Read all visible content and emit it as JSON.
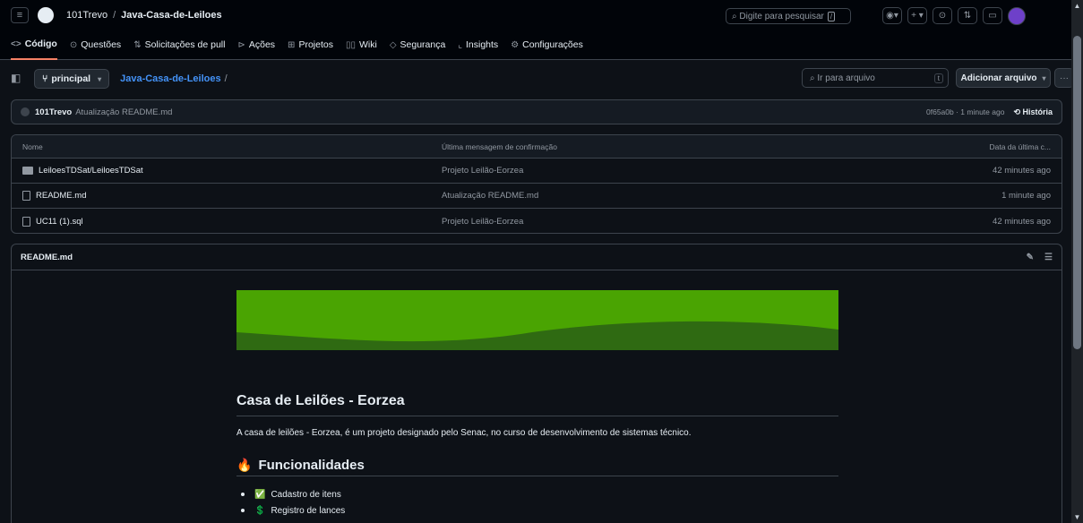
{
  "header": {
    "owner": "101Trevo",
    "repo": "Java-Casa-de-Leiloes",
    "search_placeholder": "Digite para pesquisar",
    "search_key": "/"
  },
  "nav": {
    "tabs": [
      {
        "label": "Código",
        "icon": "code-icon"
      },
      {
        "label": "Questões",
        "icon": "issue-icon"
      },
      {
        "label": "Solicitações de pull",
        "icon": "pull-request-icon"
      },
      {
        "label": "Ações",
        "icon": "play-icon"
      },
      {
        "label": "Projetos",
        "icon": "table-icon"
      },
      {
        "label": "Wiki",
        "icon": "book-icon"
      },
      {
        "label": "Segurança",
        "icon": "shield-icon"
      },
      {
        "label": "Insights",
        "icon": "graph-icon"
      },
      {
        "label": "Configurações",
        "icon": "gear-icon"
      }
    ]
  },
  "filebar": {
    "branch": "principal",
    "repo_path": "Java-Casa-de-Leiloes",
    "goto_placeholder": "Ir para arquivo",
    "goto_key": "t",
    "add_file": "Adicionar arquivo",
    "more": "···"
  },
  "commit": {
    "author": "101Trevo",
    "message": "Atualização README.md",
    "meta": "0f65a0b · 1 minute ago",
    "history": "História"
  },
  "table": {
    "headers": [
      "Nome",
      "Última mensagem de confirmação",
      "Data da última c..."
    ],
    "rows": [
      {
        "name": "LeiloesTDSat/LeiloesTDSat",
        "type": "folder",
        "message": "Projeto Leilão-Eorzea",
        "date": "42 minutes ago"
      },
      {
        "name": "README.md",
        "type": "file",
        "message": "Atualização README.md",
        "date": "1 minute ago"
      },
      {
        "name": "UC11 (1).sql",
        "type": "file",
        "message": "Projeto Leilão-Eorzea",
        "date": "42 minutes ago"
      }
    ]
  },
  "readme": {
    "title": "README.md",
    "h1": "Casa de Leilões - Eorzea",
    "intro": "A casa de leilões - Eorzea, é um projeto designado pelo Senac, no curso de desenvolvimento de sistemas técnico.",
    "h2": "Funcionalidades",
    "features": [
      {
        "emoji": "✅",
        "text": "Cadastro de itens"
      },
      {
        "emoji": "💲",
        "text": "Registro de lances"
      }
    ],
    "banner_colors": {
      "top": "#4aa402",
      "bottom": "#2f6a12"
    }
  }
}
